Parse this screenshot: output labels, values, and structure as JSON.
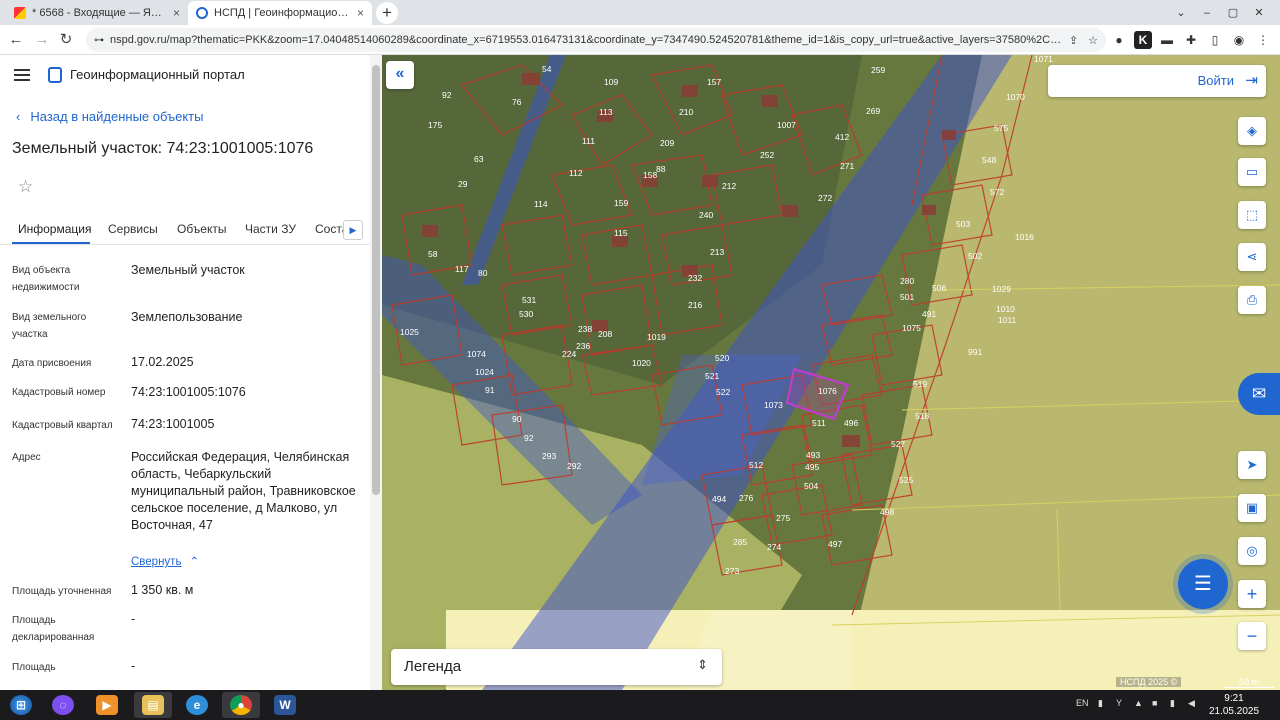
{
  "browser": {
    "tabs": [
      {
        "title": "* 6568 - Входящие — Яндекс По",
        "close": "×"
      },
      {
        "title": "НСПД | Геоинформационный п",
        "close": "×"
      }
    ],
    "new_tab": "+",
    "url": "nspd.gov.ru/map?thematic=PKK&zoom=17.04048514060289&coordinate_x=6719553.016473131&coordinate_y=7347490.524520781&theme_id=1&is_copy_url=true&active_layers=37580%2C3757..."
  },
  "sidebar": {
    "portal_title": "Геоинформационный портал",
    "back_link": "Назад в найденные объекты",
    "object_title": "Земельный участок: 74:23:1001005:1076",
    "tabs": [
      "Информация",
      "Сервисы",
      "Объекты",
      "Части ЗУ",
      "Соста"
    ],
    "fields": [
      {
        "label": "Вид объекта недвижимости",
        "value": "Земельный участок"
      },
      {
        "label": "Вид земельного участка",
        "value": "Землепользование"
      },
      {
        "label": "Дата присвоения",
        "value": "17.02.2025"
      },
      {
        "label": "Кадастровый номер",
        "value": "74:23:1001005:1076"
      },
      {
        "label": "Кадастровый квартал",
        "value": "74:23:1001005"
      },
      {
        "label": "Адрес",
        "value": "Российская Федерация, Челябинская область, Чебаркульский муниципальный район, Травниковское сельское поселение, д Малково, ул Восточная, 47"
      },
      {
        "label": "Площадь уточненная",
        "value": "1 350 кв. м"
      },
      {
        "label": "Площадь декларированная",
        "value": "-"
      },
      {
        "label": "Площадь",
        "value": "-"
      }
    ],
    "collapse_link": "Свернуть"
  },
  "map": {
    "login": "Войти",
    "legend": "Легенда",
    "copyright": "НСПД 2025 ©",
    "scale": "50 m",
    "parcels": [
      "1071",
      "1070",
      "575",
      "548",
      "572",
      "503",
      "502",
      "506",
      "1029",
      "1010",
      "1011",
      "991",
      "519",
      "518",
      "527",
      "525",
      "498",
      "497",
      "259",
      "269",
      "412",
      "271",
      "272",
      "1007",
      "252",
      "212",
      "240",
      "157",
      "210",
      "209",
      "88",
      "158",
      "159",
      "115",
      "114",
      "112",
      "111",
      "109",
      "113",
      "76",
      "92",
      "175",
      "63",
      "29",
      "54",
      "1016",
      "58",
      "117",
      "80",
      "531",
      "530",
      "238",
      "236",
      "224",
      "208",
      "213",
      "232",
      "216",
      "1019",
      "1020",
      "520",
      "521",
      "522",
      "280",
      "501",
      "1075",
      "491",
      "1076",
      "1073",
      "496",
      "511",
      "493",
      "495",
      "504",
      "512",
      "494",
      "275",
      "276",
      "274",
      "273",
      "285",
      "1024",
      "1025",
      "1074",
      "91",
      "90",
      "92",
      "293",
      "292"
    ],
    "accent": "#1f66d1"
  },
  "taskbar": {
    "lang": "EN",
    "time": "9:21",
    "date": "21.05.2025"
  }
}
